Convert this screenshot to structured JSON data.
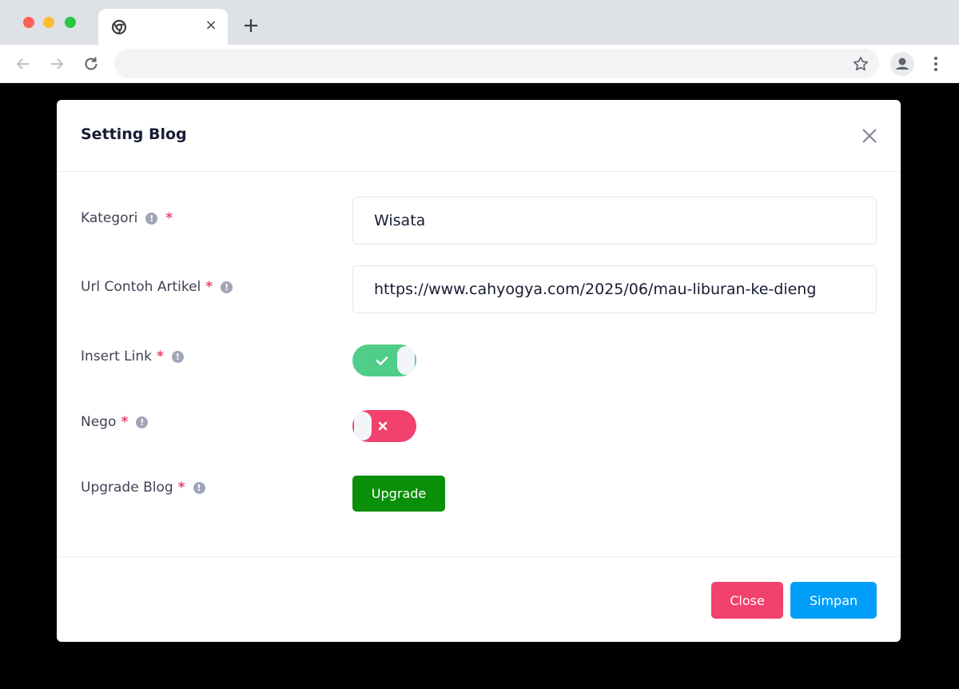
{
  "browser": {
    "tab_close_glyph": "×",
    "icons": [
      "chrome-logo-icon",
      "close-icon",
      "plus-icon",
      "back-arrow-icon",
      "forward-arrow-icon",
      "reload-icon",
      "star-icon",
      "profile-icon",
      "kebab-menu-icon"
    ]
  },
  "modal": {
    "title": "Setting Blog",
    "fields": {
      "kategori": {
        "label": "Kategori",
        "required_mark": "*",
        "value": "Wisata"
      },
      "url": {
        "label": "Url Contoh Artikel",
        "required_mark": "*",
        "value": "https://www.cahyogya.com/2025/06/mau-liburan-ke-dieng"
      },
      "insert_link": {
        "label": "Insert Link",
        "required_mark": "*",
        "checked": true
      },
      "nego": {
        "label": "Nego",
        "required_mark": "*",
        "checked": false
      },
      "upgrade_blog": {
        "label": "Upgrade Blog",
        "required_mark": "*",
        "button_label": "Upgrade"
      }
    },
    "footer": {
      "close_label": "Close",
      "save_label": "Simpan"
    },
    "info_glyph": "!"
  },
  "colors": {
    "toggle_on": "#50cd89",
    "toggle_off": "#f1416c",
    "upgrade": "#0a8f08",
    "close": "#f1416c",
    "save": "#009ef7",
    "required": "#f1416c"
  }
}
